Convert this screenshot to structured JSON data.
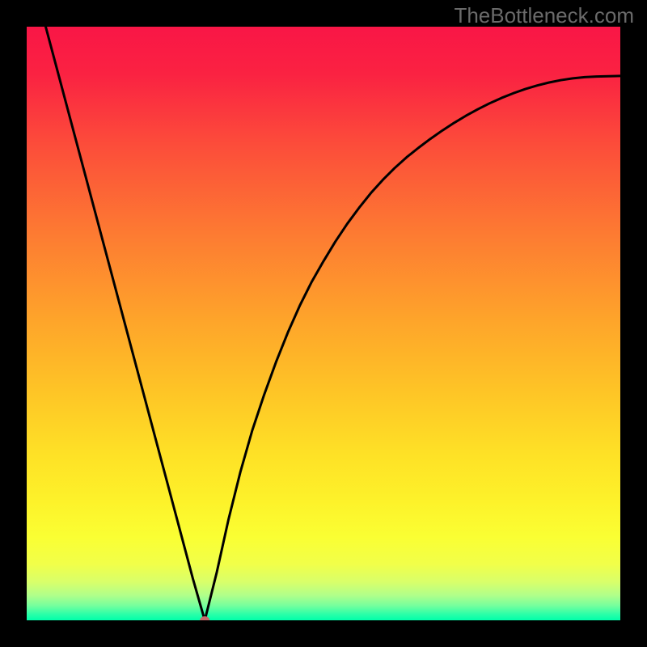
{
  "watermark": "TheBottleneck.com",
  "chart_data": {
    "type": "line",
    "title": "",
    "xlabel": "",
    "ylabel": "",
    "xlim": [
      0,
      100
    ],
    "ylim": [
      0,
      100
    ],
    "x": [
      0,
      2,
      4,
      6,
      8,
      10,
      12,
      14,
      16,
      18,
      20,
      22,
      24,
      26,
      28,
      30,
      32,
      34,
      36,
      38,
      40,
      42,
      44,
      46,
      48,
      50,
      52,
      54,
      56,
      58,
      60,
      62,
      64,
      66,
      68,
      70,
      72,
      74,
      76,
      78,
      80,
      82,
      84,
      86,
      88,
      90,
      92,
      94,
      96,
      98,
      100
    ],
    "values": [
      112,
      104.5,
      97,
      89.5,
      82,
      74.5,
      67,
      59.5,
      52,
      44.5,
      37,
      29.5,
      22,
      14.5,
      7,
      0,
      8,
      17,
      25,
      32,
      38,
      43.5,
      48.5,
      53,
      57,
      60.5,
      63.8,
      66.8,
      69.5,
      72,
      74.2,
      76.2,
      78,
      79.6,
      81.1,
      82.5,
      83.8,
      85,
      86.1,
      87.1,
      88,
      88.8,
      89.5,
      90.1,
      90.6,
      91,
      91.3,
      91.5,
      91.6,
      91.65,
      91.7
    ],
    "marker": {
      "x": 30,
      "y": 0,
      "color": "#c46a6a"
    },
    "gradient_stops": [
      {
        "offset": 0.0,
        "color": "#f91646"
      },
      {
        "offset": 0.08,
        "color": "#fa2242"
      },
      {
        "offset": 0.2,
        "color": "#fc4d3a"
      },
      {
        "offset": 0.35,
        "color": "#fd7b32"
      },
      {
        "offset": 0.5,
        "color": "#fea62a"
      },
      {
        "offset": 0.62,
        "color": "#fec626"
      },
      {
        "offset": 0.72,
        "color": "#fee126"
      },
      {
        "offset": 0.8,
        "color": "#fdf22a"
      },
      {
        "offset": 0.86,
        "color": "#faff33"
      },
      {
        "offset": 0.905,
        "color": "#f1ff49"
      },
      {
        "offset": 0.935,
        "color": "#d9ff6a"
      },
      {
        "offset": 0.958,
        "color": "#b0ff8a"
      },
      {
        "offset": 0.975,
        "color": "#77ff9d"
      },
      {
        "offset": 0.99,
        "color": "#2affa8"
      },
      {
        "offset": 1.0,
        "color": "#00ffaa"
      }
    ],
    "curve_color": "#000000",
    "curve_width": 3
  }
}
